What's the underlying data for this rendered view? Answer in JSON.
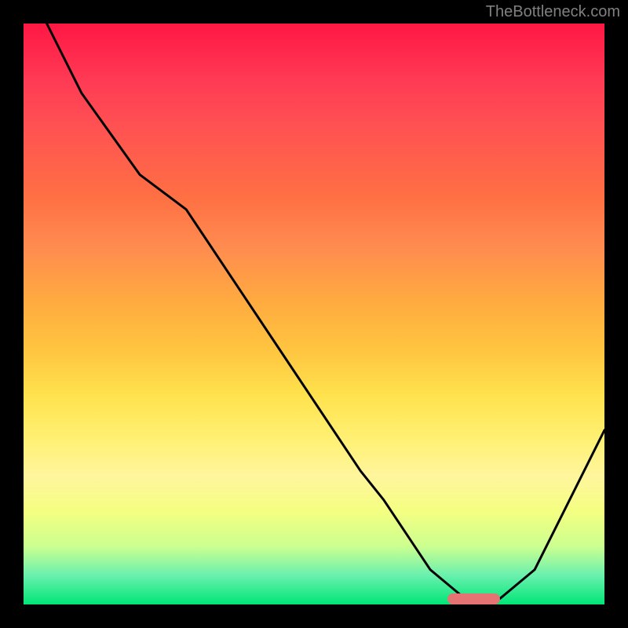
{
  "watermark": "TheBottleneck.com",
  "chart_data": {
    "type": "line",
    "title": "",
    "xlabel": "",
    "ylabel": "",
    "xlim": [
      0,
      100
    ],
    "ylim": [
      0,
      100
    ],
    "series": [
      {
        "name": "curve",
        "x": [
          4,
          10,
          20,
          28,
          40,
          50,
          58,
          62,
          70,
          76,
          82,
          88,
          100
        ],
        "values": [
          100,
          88,
          74,
          68,
          50,
          35,
          23,
          18,
          6,
          1,
          1,
          6,
          30
        ]
      }
    ],
    "highlight_segment": {
      "x_start": 73,
      "x_end": 82,
      "y": 1
    },
    "gradient": {
      "stops": [
        {
          "pos": 0,
          "color": "#ff1744"
        },
        {
          "pos": 18,
          "color": "#ff5252"
        },
        {
          "pos": 38,
          "color": "#ff8a50"
        },
        {
          "pos": 56,
          "color": "#ffc440"
        },
        {
          "pos": 72,
          "color": "#fff176"
        },
        {
          "pos": 84,
          "color": "#f4ff81"
        },
        {
          "pos": 95,
          "color": "#69f0ae"
        },
        {
          "pos": 100,
          "color": "#00e676"
        }
      ]
    }
  }
}
